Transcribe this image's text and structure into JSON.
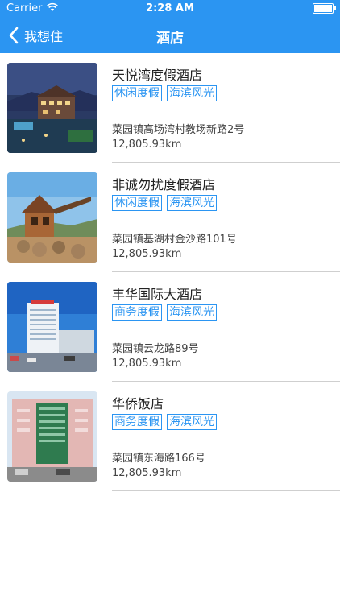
{
  "status": {
    "carrier": "Carrier",
    "time": "2:28 AM"
  },
  "nav": {
    "back_label": "我想住",
    "title": "酒店"
  },
  "hotels": [
    {
      "name": "天悦湾度假酒店",
      "tags": [
        "休闲度假",
        "海滨风光"
      ],
      "address": "菜园镇高场湾村教场新路2号",
      "distance": "12,805.93km",
      "image": "resort-night-photo"
    },
    {
      "name": "非诚勿扰度假酒店",
      "tags": [
        "休闲度假",
        "海滨风光"
      ],
      "address": "菜园镇基湖村金沙路101号",
      "distance": "12,805.93km",
      "image": "wooden-house-photo"
    },
    {
      "name": "丰华国际大酒店",
      "tags": [
        "商务度假",
        "海滨风光"
      ],
      "address": "菜园镇云龙路89号",
      "distance": "12,805.93km",
      "image": "tower-hotel-photo"
    },
    {
      "name": "华侨饭店",
      "tags": [
        "商务度假",
        "海滨风光"
      ],
      "address": "菜园镇东海路166号",
      "distance": "12,805.93km",
      "image": "pink-building-photo"
    }
  ]
}
